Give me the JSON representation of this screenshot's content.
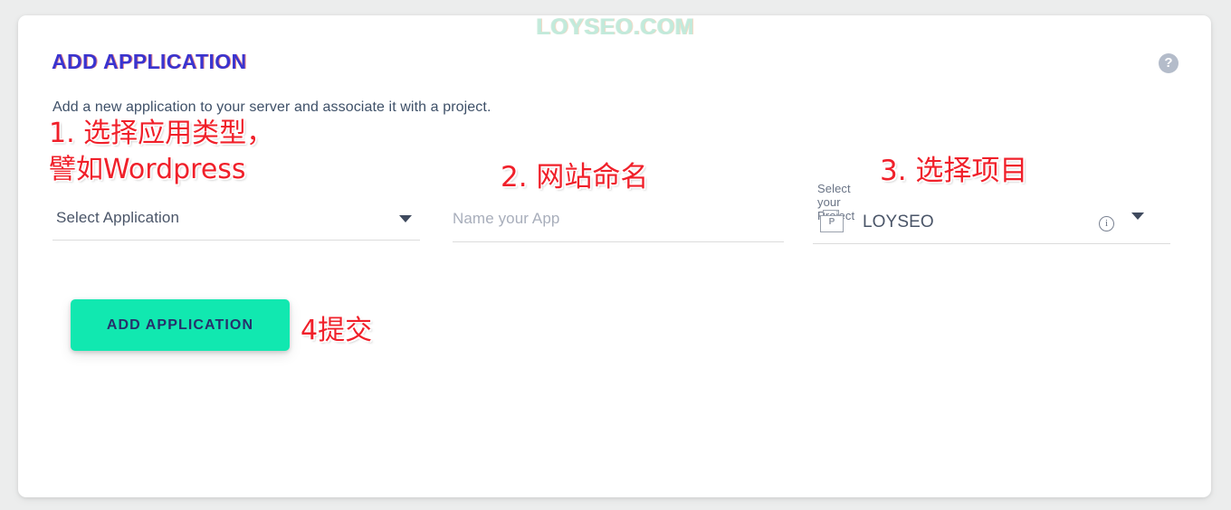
{
  "watermark": {
    "text": "LOYSEO.COM"
  },
  "card": {
    "title": "ADD APPLICATION",
    "subtitle": "Add a new application to your server and associate it with a project.",
    "help_icon_label": "?",
    "accent_color": "#3a34cf",
    "button_color": "#11e8b0"
  },
  "form": {
    "application_select": {
      "value": "Select Application",
      "caret_icon": "chevron-down-icon"
    },
    "app_name_input": {
      "value": "",
      "placeholder": "Name your App"
    },
    "project_select": {
      "label": "Select your Project",
      "value": "LOYSEO",
      "icon_letter": "P",
      "info_icon": "i",
      "caret_icon": "chevron-down-icon"
    },
    "submit_button": {
      "label": "ADD APPLICATION"
    }
  },
  "annotations": {
    "step1": "1. 选择应用类型，\n譬如Wordpress",
    "step2": "2. 网站命名",
    "step3": "3. 选择项目",
    "step4": "4提交",
    "color": "#f0202a"
  }
}
